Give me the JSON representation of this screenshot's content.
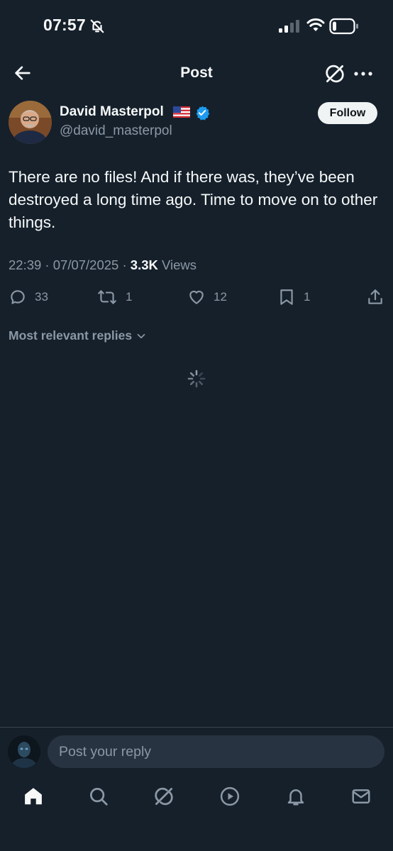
{
  "status_bar": {
    "time": "07:57"
  },
  "header": {
    "title": "Post"
  },
  "author": {
    "name": "David Masterpol",
    "handle": "@david_masterpol",
    "follow_label": "Follow"
  },
  "post": {
    "text": "There are no files! And if there was, they’ve been destroyed a long time ago. Time to move on to other things.",
    "timestamp": "22:39 · 07/07/2025 · ",
    "views_count": "3.3K",
    "views_label": " Views"
  },
  "actions": {
    "replies": "33",
    "reposts": "1",
    "likes": "12",
    "bookmarks": "1"
  },
  "replies_sort": {
    "label": "Most relevant replies"
  },
  "composer": {
    "placeholder": "Post your reply"
  },
  "icons": {
    "back": "arrow-left-icon",
    "grok": "grok-icon",
    "more": "more-icon",
    "verified": "verified-badge-icon",
    "reply": "reply-icon",
    "repost": "repost-icon",
    "like": "heart-icon",
    "bookmark": "bookmark-icon",
    "share": "share-icon",
    "home": "home-icon",
    "search": "search-icon",
    "video": "play-icon",
    "notifications": "bell-icon",
    "messages": "mail-icon"
  },
  "colors": {
    "background": "#15202b",
    "verified": "#1d9bf0",
    "muted": "#8b98a5"
  }
}
